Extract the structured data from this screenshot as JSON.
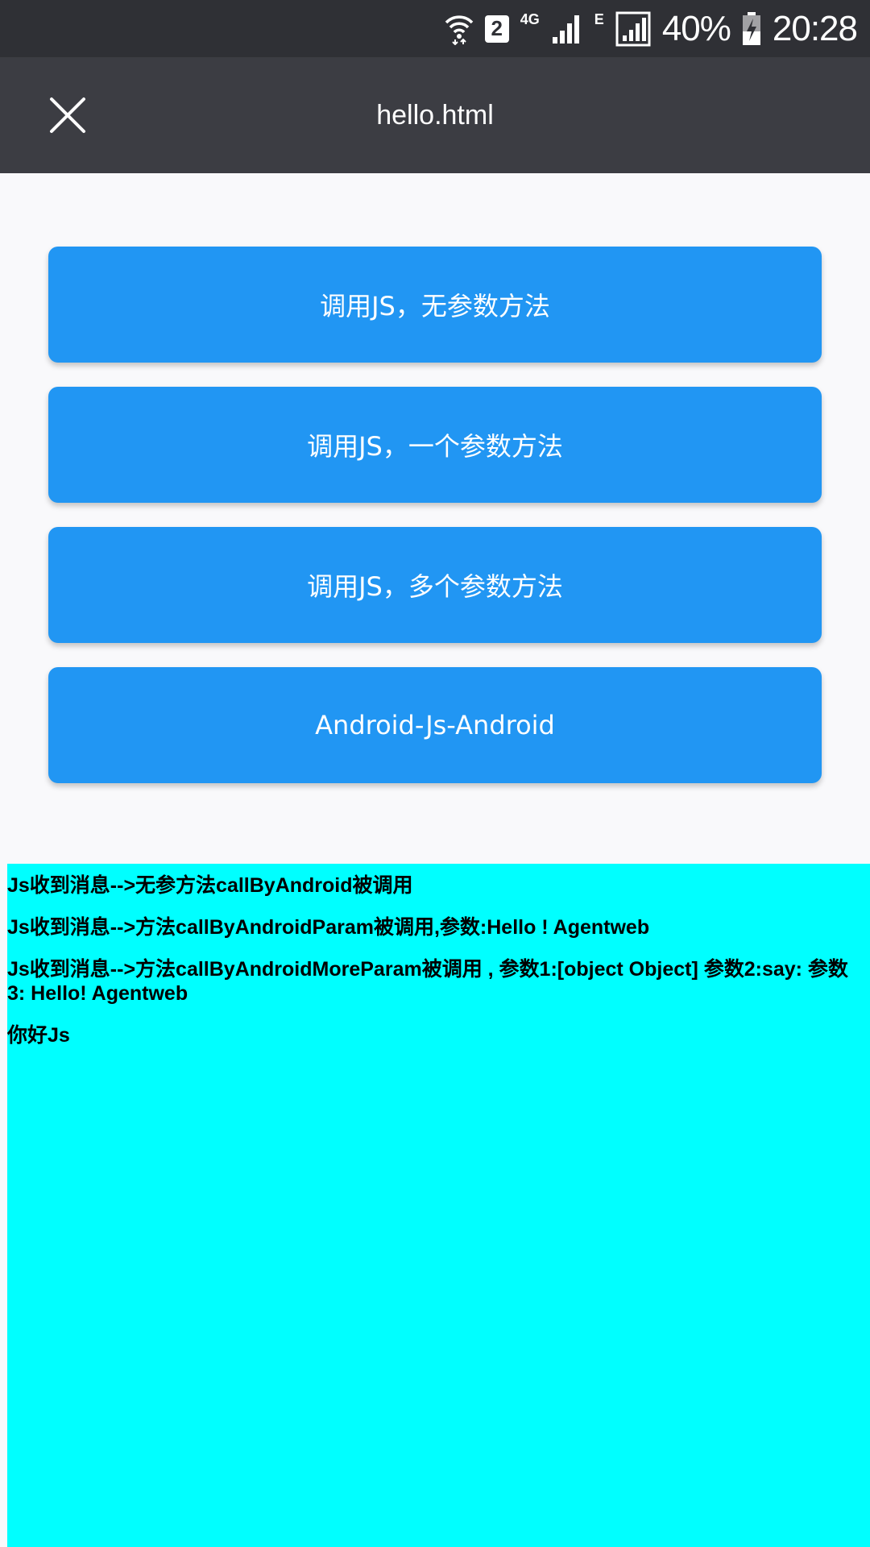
{
  "status_bar": {
    "sim_slot": "2",
    "network_type": "4G",
    "network_type_2": "E",
    "battery_percent": "40%",
    "time": "20:28"
  },
  "toolbar": {
    "title": "hello.html"
  },
  "buttons": [
    {
      "label": "调用JS，无参数方法"
    },
    {
      "label": "调用JS，一个参数方法"
    },
    {
      "label": "调用JS，多个参数方法"
    },
    {
      "label": "Android-Js-Android"
    }
  ],
  "log": {
    "lines": [
      "Js收到消息-->无参方法callByAndroid被调用",
      "Js收到消息-->方法callByAndroidParam被调用,参数:Hello ! Agentweb",
      "Js收到消息-->方法callByAndroidMoreParam被调用 , 参数1:[object Object] 参数2:say: 参数3: Hello! Agentweb",
      "你好Js"
    ]
  },
  "colors": {
    "status_bar_bg": "#2f3035",
    "toolbar_bg": "#3c3d43",
    "button_bg": "#2196f3",
    "log_bg": "#00ffff",
    "page_bg": "#f9f9fb"
  }
}
